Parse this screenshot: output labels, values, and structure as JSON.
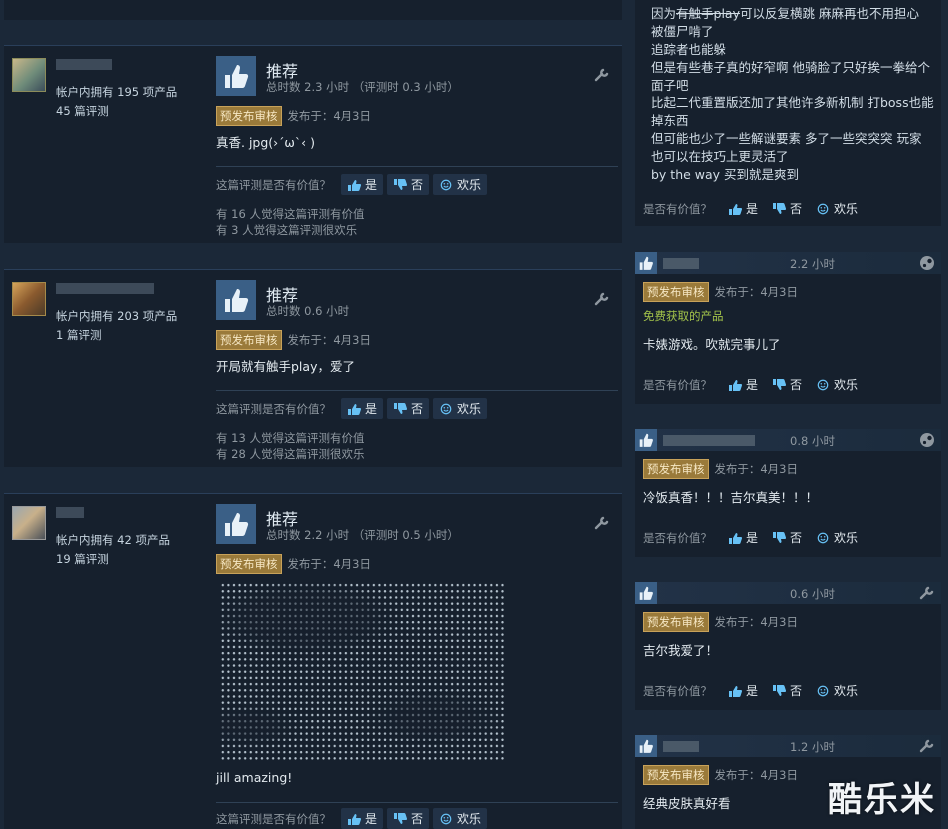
{
  "left_reviews": [
    {
      "owned": "帐户内拥有 195 项产品",
      "reviews": "45 篇评测",
      "rec_title": "推荐",
      "hours": "总时数 2.3 小时 （评测时 0.3 小时）",
      "badge": "预发布审核",
      "posted": "发布于：4月3日",
      "text": "真香. jpg(›´ω`‹ )",
      "vote_question": "这篇评测是否有价值？",
      "yes": "是",
      "no": "否",
      "funny": "欢乐",
      "helpful": "有 16 人觉得这篇评测有价值",
      "funny_count": "有 3 人觉得这篇评测很欢乐"
    },
    {
      "owned": "帐户内拥有 203 项产品",
      "reviews": "1 篇评测",
      "rec_title": "推荐",
      "hours": "总时数 0.6 小时",
      "badge": "预发布审核",
      "posted": "发布于：4月3日",
      "text": "开局就有触手play，爱了",
      "vote_question": "这篇评测是否有价值？",
      "yes": "是",
      "no": "否",
      "funny": "欢乐",
      "helpful": "有 13 人觉得这篇评测有价值",
      "funny_count": "有 28 人觉得这篇评测很欢乐"
    },
    {
      "owned": "帐户内拥有 42 项产品",
      "reviews": "19 篇评测",
      "rec_title": "推荐",
      "hours": "总时数 2.2 小时 （评测时 0.5 小时）",
      "badge": "预发布审核",
      "posted": "发布于：4月3日",
      "text": "jill amazing!",
      "vote_question": "这篇评测是否有价值？",
      "yes": "是",
      "no": "否",
      "funny": "欢乐"
    }
  ],
  "right_top": {
    "line_prefix": "因为",
    "line_struck": "有触手play",
    "line_rest": "可以反复横跳 麻麻再也不用担心",
    "lines": [
      "被僵尸啃了",
      "追踪者也能躲",
      "但是有些巷子真的好窄啊 他骑脸了只好挨一拳给个",
      "面子吧",
      "比起二代重置版还加了其他许多新机制 打boss也能",
      "掉东西",
      "但可能也少了一些解谜要素 多了一些突突突 玩家",
      "也可以在技巧上更灵活了",
      "by the way 买到就是爽到"
    ],
    "vote_question": "是否有价值？",
    "yes": "是",
    "no": "否",
    "funny": "欢乐"
  },
  "right_cards": [
    {
      "hours": "2.2 小时",
      "badge": "预发布审核",
      "posted": "发布于：4月3日",
      "free": "免费获取的产品",
      "text": "卡婊游戏。吹就完事儿了",
      "vote_question": "是否有价值？",
      "yes": "是",
      "no": "否",
      "funny": "欢乐"
    },
    {
      "hours": "0.8 小时",
      "badge": "预发布审核",
      "posted": "发布于：4月3日",
      "text": "冷饭真香！！！吉尔真美！！！",
      "vote_question": "是否有价值？",
      "yes": "是",
      "no": "否",
      "funny": "欢乐"
    },
    {
      "hours": "0.6 小时",
      "badge": "预发布审核",
      "posted": "发布于：4月3日",
      "text": "吉尔我爱了！",
      "vote_question": "是否有价值？",
      "yes": "是",
      "no": "否",
      "funny": "欢乐"
    },
    {
      "hours": "1.2 小时",
      "badge": "预发布审核",
      "posted": "发布于：4月3日",
      "text": "经典皮肤真好看"
    }
  ],
  "watermark": "酷乐米",
  "colors": {
    "background": "#1b2838",
    "card": "#16202d",
    "thumb": "#3a5f86",
    "badge": "#9a7a3a"
  }
}
